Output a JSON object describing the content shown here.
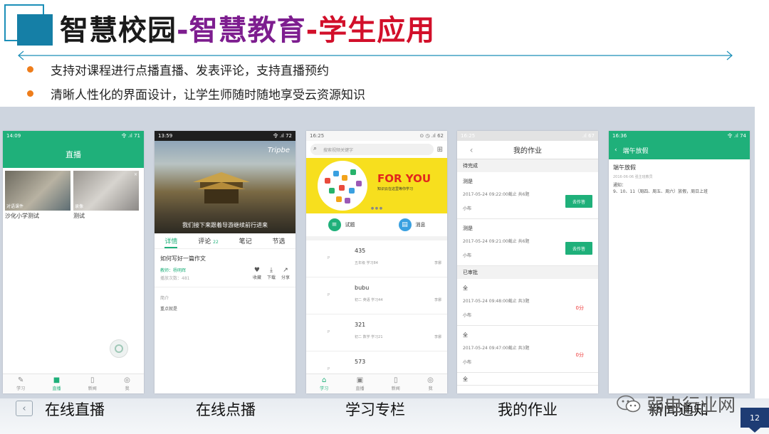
{
  "slide": {
    "title_part1": "智慧校园",
    "title_part2": "-智慧教育",
    "title_part3": "-学生应用",
    "bullets": [
      "支持对课程进行点播直播、发表评论，支持直播预约",
      "清晰人性化的界面设计，让学生师随时随地享受云资源知识"
    ],
    "captions": [
      "在线直播",
      "在线点播",
      "学习专栏",
      "我的作业",
      "新闻通知"
    ],
    "watermark": "弱电行业网",
    "page_number": "12"
  },
  "colors": {
    "green": "#1fb07a",
    "title_purple": "#7d1d8f",
    "title_red": "#d20f2a",
    "bullet_orange": "#ee7d1b",
    "page_navy": "#1e3c74"
  },
  "phone1": {
    "time": "14:09",
    "status_right": "令 .ıl 71",
    "header": "直播",
    "thumb1_overlay": "对语课件",
    "thumb2_overlay": "录像",
    "thumb_close": "×",
    "thumb1_caption": "沙化小学测试",
    "thumb2_caption": "测试",
    "tabs": [
      {
        "icon": "edit-icon",
        "glyph": "✎",
        "label": "学习"
      },
      {
        "icon": "video-camera-icon",
        "glyph": "■",
        "label": "直播"
      },
      {
        "icon": "document-icon",
        "glyph": "▯",
        "label": "新闻"
      },
      {
        "icon": "user-icon",
        "glyph": "◎",
        "label": "我"
      }
    ]
  },
  "phone2": {
    "time": "13:59",
    "status_right": "令 .ıl 72",
    "video_caption": "我们接下来跟着导游继续前行进来",
    "video_watermark": "Tripbe",
    "tabs": [
      "详情",
      "评论",
      "笔记",
      "节选"
    ],
    "tab_count": "22",
    "lesson_title": "如何写好一篇作文",
    "teacher": "教师：杨明辉",
    "teacher_sub": "播放次数：481",
    "actions": [
      {
        "icon": "heart-icon",
        "glyph": "♥",
        "label": "收藏"
      },
      {
        "icon": "download-icon",
        "glyph": "⤓",
        "label": "下载"
      },
      {
        "icon": "share-icon",
        "glyph": "↗",
        "label": "分享"
      }
    ],
    "intro_label": "简介",
    "intro_text": "重点就是"
  },
  "phone3": {
    "time": "16:25",
    "status_right": "⊙ ◷ .ıl 62",
    "search_placeholder": "搜索视频关键字",
    "banner_text": "FOR YOU",
    "banner_small": "知识云在这里等你学习",
    "quick": [
      {
        "icon": "quiz-icon",
        "label": "试题"
      },
      {
        "icon": "message-icon",
        "label": "消息"
      }
    ],
    "items": [
      {
        "pic": "P",
        "name": "435",
        "meta": "五年级    学习84",
        "who": "李娜"
      },
      {
        "pic": "P",
        "name": "bubu",
        "meta": "初二 英语    学习44",
        "who": "李娜"
      },
      {
        "pic": "P",
        "name": "321",
        "meta": "初二 数学    学习21",
        "who": "李娜"
      },
      {
        "pic": "P",
        "name": "573",
        "meta": "",
        "who": ""
      }
    ],
    "tabs": [
      {
        "icon": "home-icon",
        "glyph": "⌂",
        "label": "学习"
      },
      {
        "icon": "camera-icon",
        "glyph": "▣",
        "label": "直播"
      },
      {
        "icon": "document-icon",
        "glyph": "▯",
        "label": "新闻"
      },
      {
        "icon": "user-icon",
        "glyph": "◎",
        "label": "我"
      }
    ]
  },
  "phone4": {
    "time": "16:25",
    "status_right": ".ıl 67",
    "header": "我的作业",
    "section_pending": "待完成",
    "section_done": "已审批",
    "pending": [
      {
        "name": "测是",
        "date": "2017-05-24 09:22:00截止   共6题",
        "student": "小布",
        "button": "去作答"
      },
      {
        "name": "测是",
        "date": "2017-05-24 09:21:00截止   共6题",
        "student": "小布",
        "button": "去作答"
      }
    ],
    "done": [
      {
        "name": "全",
        "date": "2017-05-24 09:48:00截止   共3题",
        "student": "小布",
        "score": "0分"
      },
      {
        "name": "全",
        "date": "2017-05-24 09:47:00截止   共3题",
        "student": "小布",
        "score": "0分"
      },
      {
        "name": "全"
      }
    ]
  },
  "phone5": {
    "time": "16:36",
    "status_right": "令 .ıl 74",
    "header": "端午放假",
    "title": "端午放假",
    "meta": "2016-06-06    强主班教员",
    "body": "通知：\n    9、10、11（周四、周五、周六）放假，周日上班"
  }
}
